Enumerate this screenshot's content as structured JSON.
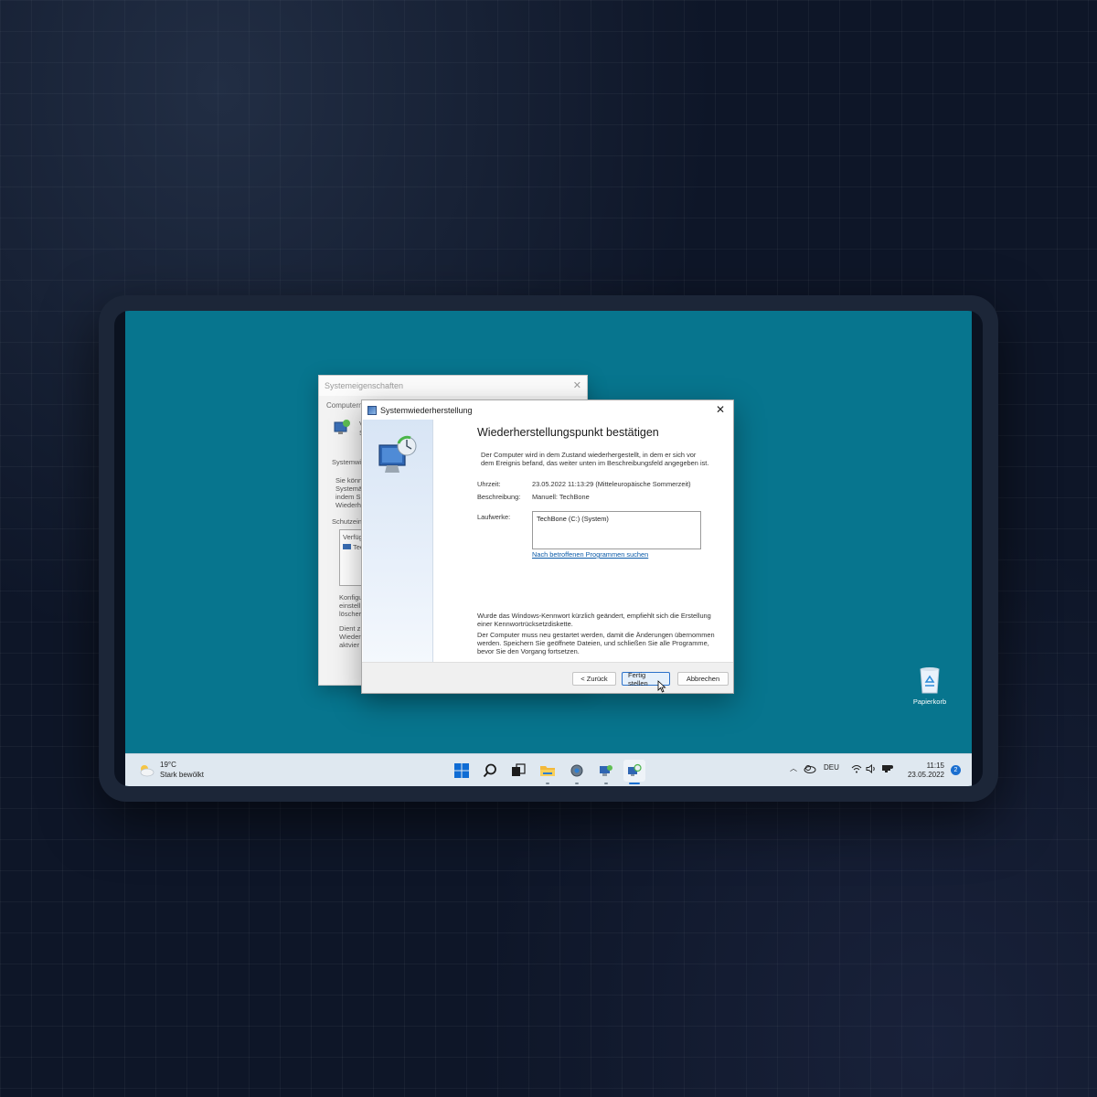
{
  "back_window": {
    "title": "Systemeigenschaften",
    "tab_fragment": "Computern",
    "fragments": [
      "V",
      "S",
      "Systemwi",
      "Sie könn",
      "Systemä",
      "indem Si",
      "Wiederhe",
      "Schutzein",
      "Verfüg",
      "Tec",
      "Konfigu",
      "einstell",
      "löscher",
      "Dient z",
      "Wieder",
      "aktvier"
    ]
  },
  "dialog": {
    "title": "Systemwiederherstellung",
    "heading": "Wiederherstellungspunkt bestätigen",
    "intro": "Der Computer wird in dem Zustand wiederhergestellt, in dem er sich vor dem Ereignis befand, das weiter unten im Beschreibungsfeld angegeben ist.",
    "time_label": "Uhrzeit:",
    "time_value": "23.05.2022 11:13:29 (Mitteleuropäische Sommerzeit)",
    "desc_label": "Beschreibung:",
    "desc_value": "Manuell: TechBone",
    "drives_label": "Laufwerke:",
    "drive_item": "TechBone (C:) (System)",
    "link": "Nach betroffenen Programmen suchen",
    "note1": "Wurde das Windows-Kennwort kürzlich geändert, empfiehlt sich die Erstellung einer Kennwortrücksetzdiskette.",
    "note2": "Der Computer muss neu gestartet werden, damit die Änderungen übernommen werden. Speichern Sie geöffnete Dateien, und schließen Sie alle Programme, bevor Sie den Vorgang fortsetzen.",
    "back_button": "< Zurück",
    "finish_button": "Fertig stellen",
    "cancel_button": "Abbrechen"
  },
  "desktop": {
    "recycle_bin": "Papierkorb"
  },
  "taskbar": {
    "weather_temp": "19°C",
    "weather_desc": "Stark bewölkt",
    "language": "DEU",
    "time": "11:15",
    "date": "23.05.2022",
    "notification_count": "2",
    "icons": [
      "windows-start-icon",
      "search-icon",
      "task-view-icon",
      "file-explorer-icon",
      "settings-icon",
      "system-properties-icon",
      "system-restore-icon"
    ]
  },
  "colors": {
    "desktop": "#07758e",
    "accent": "#1a6fd0",
    "link": "#0a5aa8"
  }
}
